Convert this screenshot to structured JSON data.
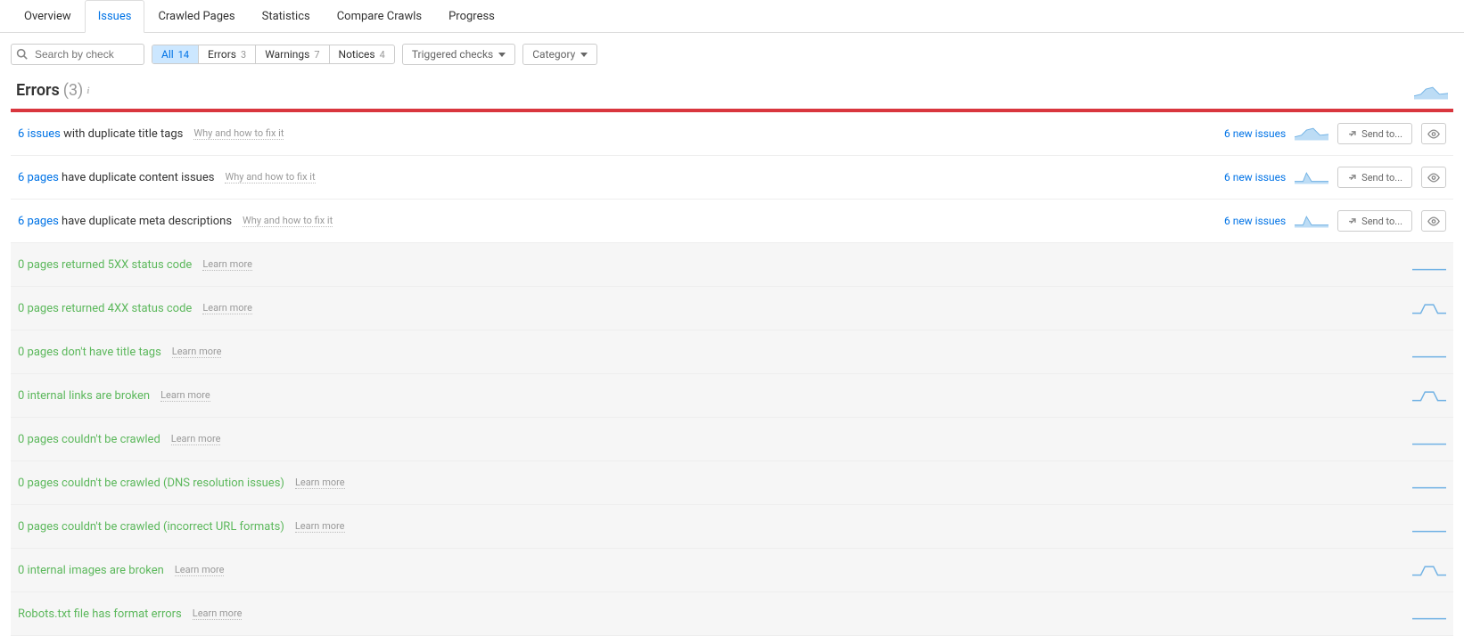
{
  "tabs": [
    "Overview",
    "Issues",
    "Crawled Pages",
    "Statistics",
    "Compare Crawls",
    "Progress"
  ],
  "active_tab": 1,
  "search": {
    "placeholder": "Search by check"
  },
  "pills": [
    {
      "label": "All",
      "count": "14",
      "active": true
    },
    {
      "label": "Errors",
      "count": "3"
    },
    {
      "label": "Warnings",
      "count": "7"
    },
    {
      "label": "Notices",
      "count": "4"
    }
  ],
  "dropdowns": [
    "Triggered checks",
    "Category"
  ],
  "section": {
    "title": "Errors",
    "count": "(3)"
  },
  "help_active": "Why and how to fix it",
  "help_zero": "Learn more",
  "send_to": "Send to...",
  "issues": [
    {
      "prefix": "6 issues",
      "text": " with duplicate title tags",
      "new": "6 new issues",
      "zero": false,
      "spark": "area"
    },
    {
      "prefix": "6 pages",
      "text": " have duplicate content issues",
      "new": "6 new issues",
      "zero": false,
      "spark": "bump"
    },
    {
      "prefix": "6 pages",
      "text": " have duplicate meta descriptions",
      "new": "6 new issues",
      "zero": false,
      "spark": "bump"
    },
    {
      "prefix": "0 pages returned 5XX status code",
      "text": "",
      "zero": true,
      "spark": "flat"
    },
    {
      "prefix": "0 pages returned 4XX status code",
      "text": "",
      "zero": true,
      "spark": "hump"
    },
    {
      "prefix": "0 pages don't have title tags",
      "text": "",
      "zero": true,
      "spark": "flat"
    },
    {
      "prefix": "0 internal links are broken",
      "text": "",
      "zero": true,
      "spark": "hump"
    },
    {
      "prefix": "0 pages couldn't be crawled",
      "text": "",
      "zero": true,
      "spark": "flat"
    },
    {
      "prefix": "0 pages couldn't be crawled (DNS resolution issues)",
      "text": "",
      "zero": true,
      "spark": "flat"
    },
    {
      "prefix": "0 pages couldn't be crawled (incorrect URL formats)",
      "text": "",
      "zero": true,
      "spark": "flat"
    },
    {
      "prefix": "0 internal images are broken",
      "text": "",
      "zero": true,
      "spark": "hump"
    },
    {
      "prefix": "Robots.txt file has format errors",
      "text": "",
      "zero": true,
      "spark": "flat"
    }
  ]
}
